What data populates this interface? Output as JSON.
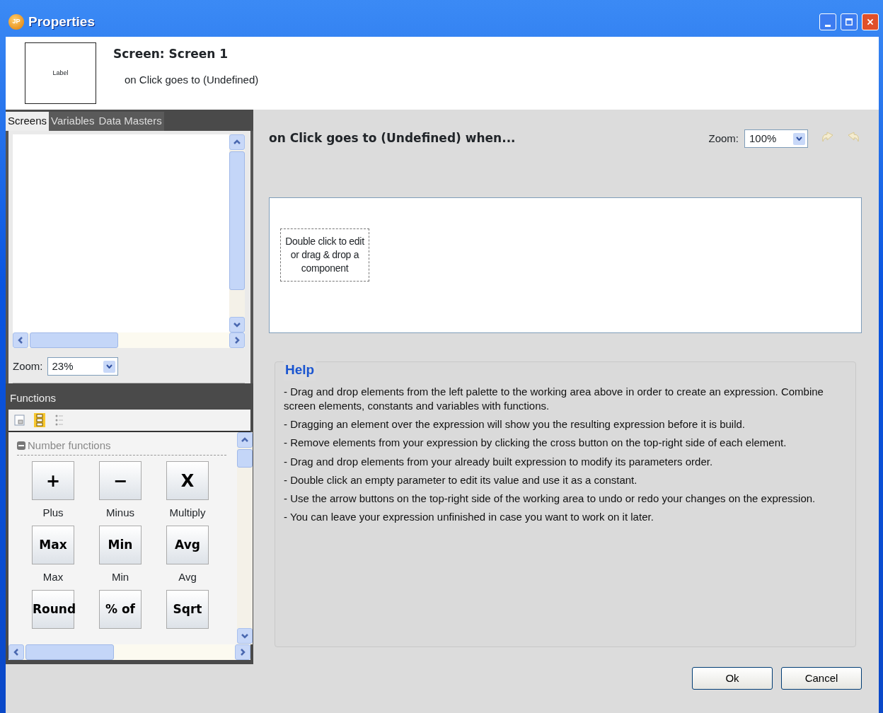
{
  "window": {
    "title": "Properties",
    "app_badge": "JP"
  },
  "header": {
    "preview_label": "Label",
    "title": "Screen: Screen 1",
    "subtitle": "on Click goes to (Undefined)"
  },
  "left_tabs": [
    {
      "label": "Screens",
      "selected": true
    },
    {
      "label": "Variables",
      "selected": false
    },
    {
      "label": "Data Masters",
      "selected": false
    }
  ],
  "preview": {
    "zoom_label": "Zoom:",
    "zoom_value": "23%"
  },
  "functions": {
    "title": "Functions",
    "toolbar": [
      {
        "selected": false
      },
      {
        "selected": true
      },
      {
        "selected": false
      }
    ],
    "section": {
      "title": "Number functions",
      "expanded": true
    },
    "items": [
      {
        "symbol": "+",
        "label": "Plus"
      },
      {
        "symbol": "−",
        "label": "Minus"
      },
      {
        "symbol": "X",
        "label": "Multiply"
      },
      {
        "symbol": "Max",
        "label": "Max"
      },
      {
        "symbol": "Min",
        "label": "Min"
      },
      {
        "symbol": "Avg",
        "label": "Avg"
      },
      {
        "symbol": "Round"
      },
      {
        "symbol": "% of"
      },
      {
        "symbol": "Sqrt"
      }
    ]
  },
  "editor": {
    "heading": "on Click goes to (Undefined) when...",
    "zoom_label": "Zoom:",
    "zoom_value": "100%",
    "undo_disabled": true,
    "redo_disabled": true,
    "placeholder": "Double click to edit or drag & drop a component"
  },
  "help": {
    "title": "Help",
    "items": [
      "- Drag and drop elements from the left palette to the working area above in order to create an expression. Combine screen elements, constants and variables with functions.",
      "- Dragging an element over the expression will show you the resulting expression before it is build.",
      "- Remove elements from your expression by clicking the cross button on the top-right side of each element.",
      "- Drag and drop elements from your already built expression to modify its parameters order.",
      "- Double click an empty parameter to edit its value and use it as a constant.",
      "- Use the arrow buttons on the top-right side of the working area to undo or redo your changes on the expression.",
      "- You can leave your expression unfinished in case you want to work on it later."
    ]
  },
  "buttons": [
    {
      "label": "Ok"
    },
    {
      "label": "Cancel"
    }
  ]
}
